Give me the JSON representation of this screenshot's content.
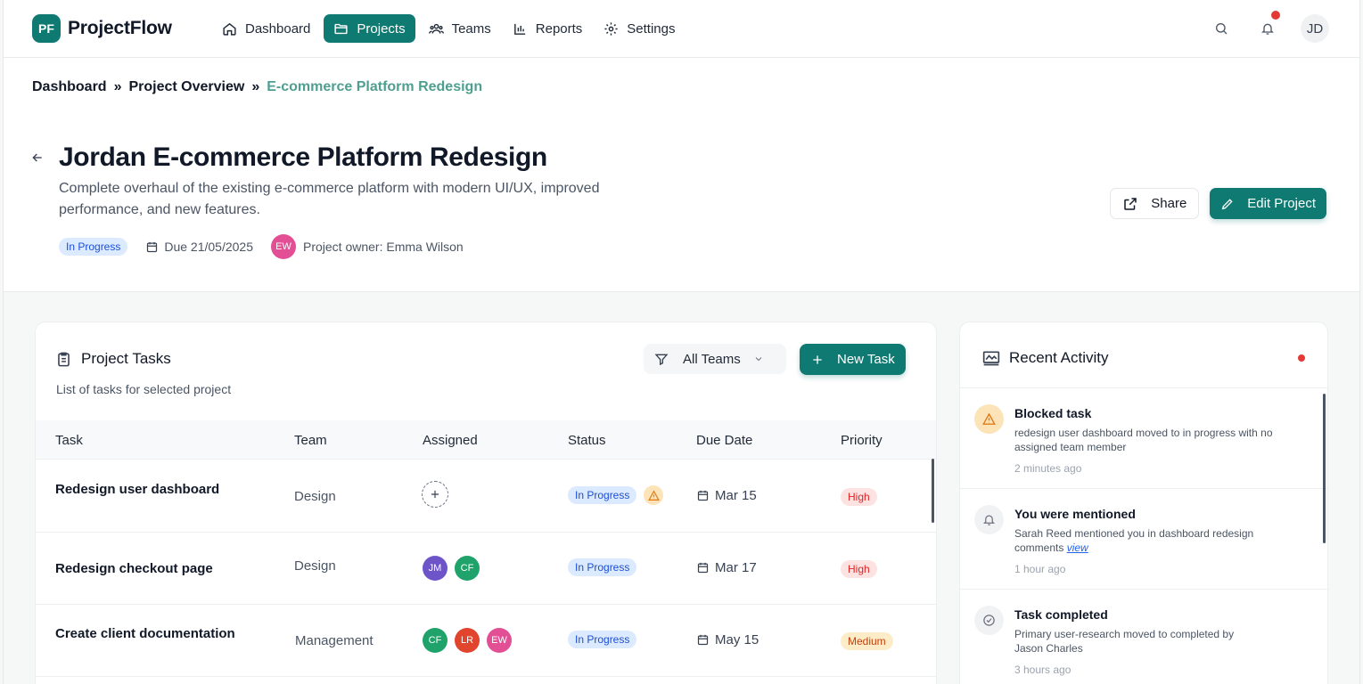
{
  "app": {
    "logo_initials": "PF",
    "name": "ProjectFlow",
    "user_initials": "JD",
    "accent": "#0f7a72"
  },
  "nav": [
    {
      "label": "Dashboard",
      "icon": "home-icon",
      "active": false
    },
    {
      "label": "Projects",
      "icon": "folder-icon",
      "active": true
    },
    {
      "label": "Teams",
      "icon": "users-icon",
      "active": false
    },
    {
      "label": "Reports",
      "icon": "bar-chart-icon",
      "active": false
    },
    {
      "label": "Settings",
      "icon": "gear-icon",
      "active": false
    }
  ],
  "breadcrumb": {
    "items": [
      "Dashboard",
      "Project Overview"
    ],
    "current": "E-commerce Platform Redesign",
    "separator": "»"
  },
  "project": {
    "title": "Jordan E-commerce Platform Redesign",
    "description": "Complete overhaul of the existing e-commerce platform with modern UI/UX, improved performance, and new features.",
    "status": "In Progress",
    "due": "Due 21/05/2025",
    "owner_initials": "EW",
    "owner_label": "Project owner: Emma Wilson"
  },
  "actions": {
    "share": "Share",
    "edit": "Edit Project"
  },
  "tasks": {
    "title": "Project Tasks",
    "subtitle": "List of tasks for selected project",
    "filter": "All Teams",
    "new_task": "New Task",
    "columns": [
      "Task",
      "Team",
      "Assigned",
      "Status",
      "Due Date",
      "Priority"
    ],
    "rows": [
      {
        "name": "Redesign user dashboard",
        "team": "Design",
        "assigned": [],
        "status": "In Progress",
        "warning": true,
        "due": "Mar 15",
        "priority": "High"
      },
      {
        "name": "Redesign checkout page",
        "team": "Design",
        "assigned": [
          "JM",
          "CF"
        ],
        "status": "In Progress",
        "warning": false,
        "due": "Mar 17",
        "priority": "High"
      },
      {
        "name": "Create client documentation",
        "team": "Management",
        "assigned": [
          "CF",
          "LR",
          "EW"
        ],
        "status": "In Progress",
        "warning": false,
        "due": "May 15",
        "priority": "Medium"
      }
    ]
  },
  "activity": {
    "title": "Recent Activity",
    "items": [
      {
        "icon": "warning-icon",
        "title": "Blocked task",
        "body": "redesign user dashboard moved to in progress with no assigned team member",
        "link": "",
        "time": "2 minutes ago"
      },
      {
        "icon": "bell-icon",
        "title": "You were mentioned",
        "body": "Sarah Reed mentioned you in dashboard redesign comments",
        "link": "view",
        "time": "1 hour ago"
      },
      {
        "icon": "check-circle-icon",
        "title": "Task completed",
        "body": "Primary user-research moved to completed by Jason Charles",
        "link": "",
        "time": "3 hours ago"
      }
    ]
  },
  "colors": {
    "JM": "#6d55c9",
    "CF": "#1fa36b",
    "LR": "#e2452e",
    "EW": "#e24f95",
    "status_blue": "#dbeafe",
    "priority_high": "#fde2e2",
    "priority_medium": "#fdecc8"
  }
}
